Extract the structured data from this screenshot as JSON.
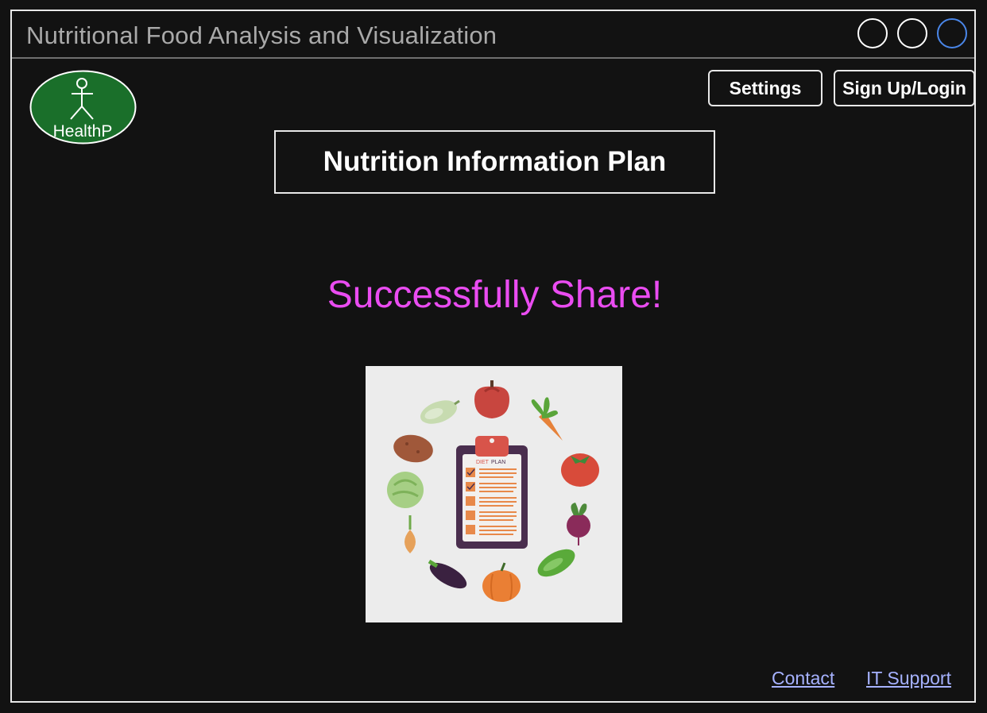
{
  "window": {
    "title": "Nutritional Food Analysis and Visualization",
    "controls": [
      "minimize",
      "maximize",
      "close"
    ]
  },
  "logo": {
    "text": "HealthP",
    "color": "#1a6f2a"
  },
  "header": {
    "settings_label": "Settings",
    "login_label": "Sign Up/Login"
  },
  "main": {
    "title": "Nutrition Information Plan",
    "message": "Successfully Share!",
    "message_color": "#ea4cf1",
    "clipboard_heading_diet": "DIET",
    "clipboard_heading_plan": "PLAN"
  },
  "footer": {
    "contact_label": "Contact",
    "support_label": "IT Support",
    "link_color": "#a6b2ff"
  }
}
